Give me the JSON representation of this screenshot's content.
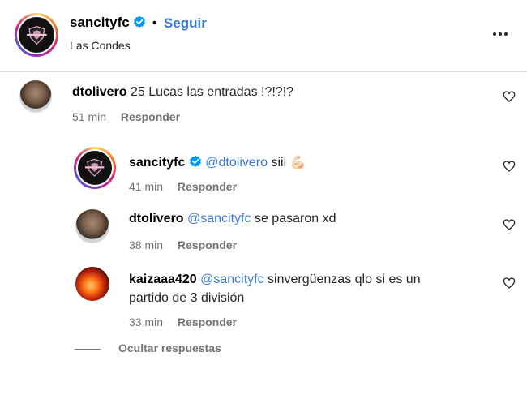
{
  "header": {
    "username": "sancityfc",
    "dot": "•",
    "follow_label": "Seguir",
    "location": "Las Condes",
    "avatar_icon": "club-logo-icon",
    "more_icon": "more-options-icon"
  },
  "comments": [
    {
      "username": "dtolivero",
      "text": "25 Lucas las entradas !?!?!?",
      "mention": "",
      "time": "51 min",
      "reply_label": "Responder"
    },
    {
      "username": "sancityfc",
      "mention": "@dtolivero",
      "text": "siii 💪🏻",
      "time": "41 min",
      "reply_label": "Responder"
    },
    {
      "username": "dtolivero",
      "mention": "@sancityfc",
      "text": "se pasaron xd",
      "time": "38 min",
      "reply_label": "Responder"
    },
    {
      "username": "kaizaaa420",
      "mention": "@sancityfc",
      "text_line1": "sinvergüenzas qlo si es un",
      "text_line2": "partido de 3 división",
      "time": "33 min",
      "reply_label": "Responder"
    }
  ],
  "hide_replies_label": "Ocultar respuestas",
  "colors": {
    "link": "#3a7bd5",
    "muted": "#737373",
    "verified": "#0095f6"
  }
}
